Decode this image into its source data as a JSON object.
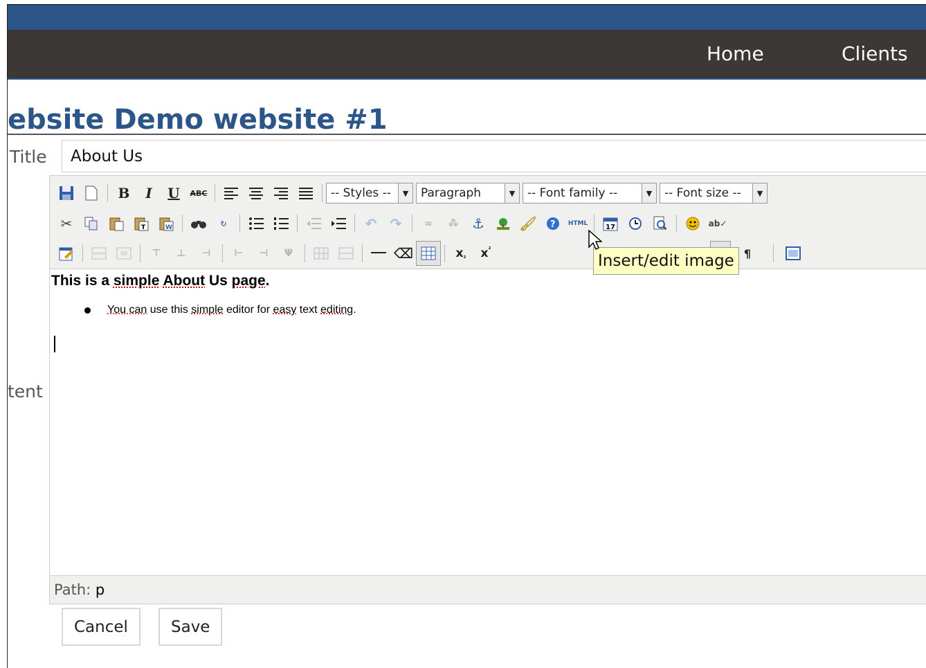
{
  "nav": {
    "items": [
      "Home",
      "Clients"
    ]
  },
  "page": {
    "title": "ebsite Demo website #1"
  },
  "form": {
    "title_label": "Title",
    "title_value": "About Us",
    "content_label": "tent",
    "cancel_label": "Cancel",
    "save_label": "Save"
  },
  "editor": {
    "styles_select": "-- Styles --",
    "format_select": "Paragraph",
    "font_family_select": "-- Font family --",
    "font_size_select": "-- Font size --",
    "content": {
      "heading_parts": [
        "This is a ",
        "simple",
        " ",
        "About",
        " Us ",
        "page",
        "."
      ],
      "bullet_parts": [
        "You can",
        " use this ",
        "simple",
        " editor for ",
        "easy",
        " text ",
        "editing",
        "."
      ]
    },
    "path_label": "Path:",
    "path_value": "p",
    "tooltip": "Insert/edit image",
    "icons": {
      "row1": [
        "save-icon",
        "new-document-icon",
        "bold-icon",
        "italic-icon",
        "underline-icon",
        "strikethrough-icon",
        "align-left-icon",
        "align-center-icon",
        "align-right-icon",
        "align-justify-icon"
      ],
      "row2": [
        "cut-icon",
        "copy-icon",
        "paste-icon",
        "paste-text-icon",
        "paste-word-icon",
        "find-icon",
        "replace-icon",
        "bullet-list-icon",
        "numbered-list-icon",
        "outdent-icon",
        "indent-icon",
        "undo-icon",
        "redo-icon",
        "link-icon",
        "unlink-icon",
        "anchor-icon",
        "image-icon",
        "cleanup-icon",
        "help-icon",
        "html-icon",
        "insert-date-icon",
        "insert-time-icon",
        "preview-icon",
        "emoticon-icon",
        "spellcheck-icon"
      ],
      "row3": [
        "edit-css-icon",
        "table-row-props-icon",
        "table-cell-props-icon",
        "insert-row-before-icon",
        "insert-row-after-icon",
        "delete-row-icon",
        "insert-col-before-icon",
        "insert-col-after-icon",
        "delete-col-icon",
        "split-cells-icon",
        "merge-cells-icon",
        "horizontal-rule-icon",
        "remove-format-icon",
        "visual-aid-icon",
        "subscript-icon",
        "superscript-icon",
        "show-blocks-icon",
        "fullscreen-icon"
      ]
    },
    "bold_glyph": "B",
    "italic_glyph": "I",
    "underline_glyph": "U",
    "strike_glyph": "ABC",
    "html_glyph": "HTML",
    "sub_glyph": "x",
    "sup_glyph": "x",
    "para_glyph": "¶"
  },
  "colors": {
    "brand_blue": "#2c5589",
    "nav_dark": "#3b3835",
    "tooltip_bg": "#ffffc4"
  }
}
